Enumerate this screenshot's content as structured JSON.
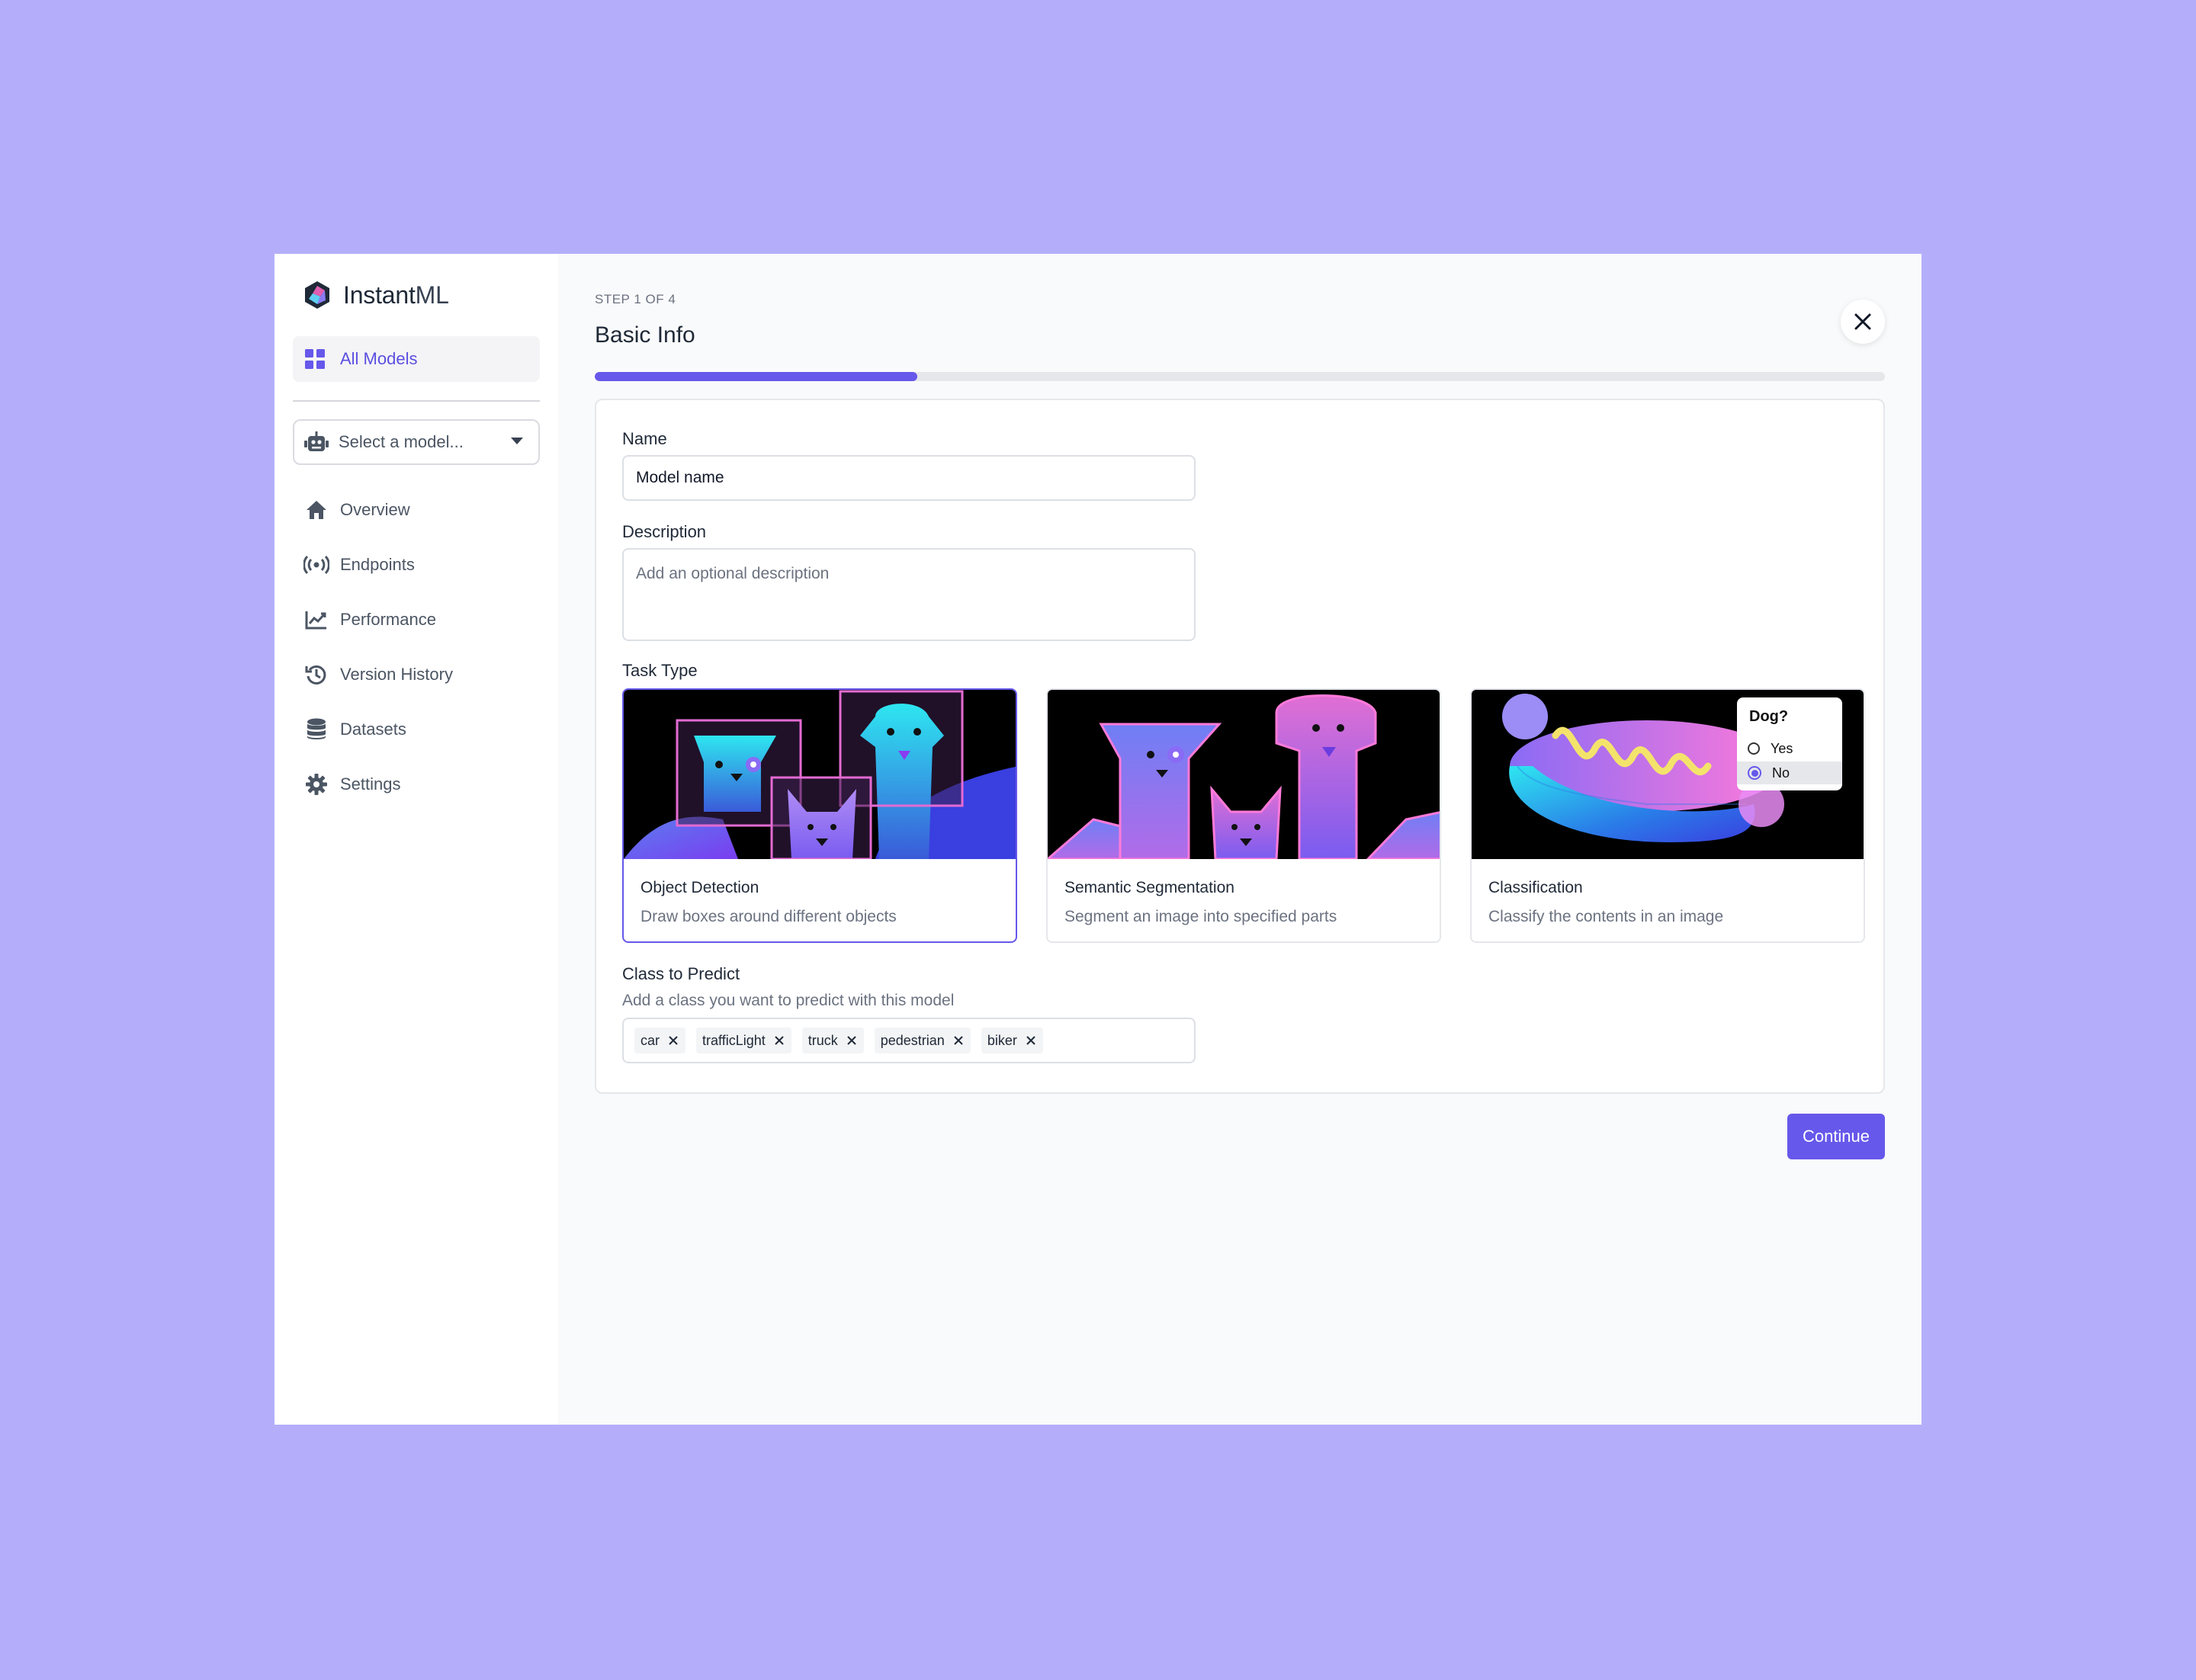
{
  "app": {
    "name_prefix": "Instant",
    "name_suffix": "ML"
  },
  "sidebar": {
    "active_item": {
      "label": "All Models",
      "icon": "grid-icon"
    },
    "model_select": {
      "placeholder": "Select a model...",
      "icon": "robot-icon"
    },
    "items": [
      {
        "label": "Overview",
        "icon": "home-icon"
      },
      {
        "label": "Endpoints",
        "icon": "broadcast-icon"
      },
      {
        "label": "Performance",
        "icon": "chart-line-icon"
      },
      {
        "label": "Version History",
        "icon": "history-icon"
      },
      {
        "label": "Datasets",
        "icon": "database-icon"
      },
      {
        "label": "Settings",
        "icon": "gear-icon"
      }
    ]
  },
  "header": {
    "step": "STEP 1 OF 4",
    "title": "Basic Info",
    "progress_fraction": 0.25
  },
  "form": {
    "name_label": "Name",
    "name_value": "Model name",
    "description_label": "Description",
    "description_placeholder": "Add an optional description",
    "task_type_label": "Task Type",
    "tasks": [
      {
        "title": "Object Detection",
        "description": "Draw boxes around different objects",
        "selected": true
      },
      {
        "title": "Semantic Segmentation",
        "description": "Segment an image into specified parts",
        "selected": false
      },
      {
        "title": "Classification",
        "description": "Classify the contents in an image",
        "selected": false
      }
    ],
    "classification_popup": {
      "question": "Dog?",
      "option_yes": "Yes",
      "option_no": "No",
      "selected": "No"
    },
    "class_label": "Class to Predict",
    "class_help": "Add a class you want to predict with this model",
    "classes": [
      "car",
      "trafficLight",
      "truck",
      "pedestrian",
      "biker"
    ]
  },
  "actions": {
    "continue_label": "Continue"
  },
  "colors": {
    "accent": "#6658ea",
    "background": "#b4aefa"
  }
}
